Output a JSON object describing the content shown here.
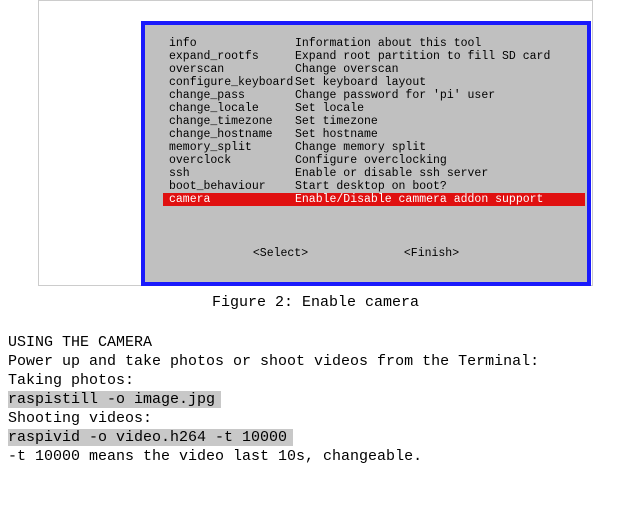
{
  "figure": {
    "menu": [
      {
        "key": "info",
        "desc": "Information about this tool"
      },
      {
        "key": "expand_rootfs",
        "desc": "Expand root partition to fill SD card"
      },
      {
        "key": "overscan",
        "desc": "Change overscan"
      },
      {
        "key": "configure_keyboard",
        "desc": "Set keyboard layout"
      },
      {
        "key": "change_pass",
        "desc": "Change password for 'pi' user"
      },
      {
        "key": "change_locale",
        "desc": "Set locale"
      },
      {
        "key": "change_timezone",
        "desc": "Set timezone"
      },
      {
        "key": "change_hostname",
        "desc": "Set hostname"
      },
      {
        "key": "memory_split",
        "desc": "Change memory split"
      },
      {
        "key": "overclock",
        "desc": "Configure overclocking"
      },
      {
        "key": "ssh",
        "desc": "Enable or disable ssh server"
      },
      {
        "key": "boot_behaviour",
        "desc": "Start desktop on boot?"
      },
      {
        "key": "camera",
        "desc": "Enable/Disable cammera addon support"
      }
    ],
    "selected_index": 12,
    "buttons": {
      "select": "<Select>",
      "finish": "<Finish>"
    },
    "caption": "Figure 2: Enable camera"
  },
  "doc": {
    "heading": "USING THE CAMERA",
    "intro": "Power up and take photos or shoot videos from the Terminal:",
    "photos_label": "Taking photos:",
    "photos_cmd": "raspistill -o image.jpg ",
    "videos_label": "Shooting videos:",
    "videos_cmd": "raspivid -o video.h264 -t 10000",
    "note": "-t 10000 means the video last 10s, changeable."
  }
}
